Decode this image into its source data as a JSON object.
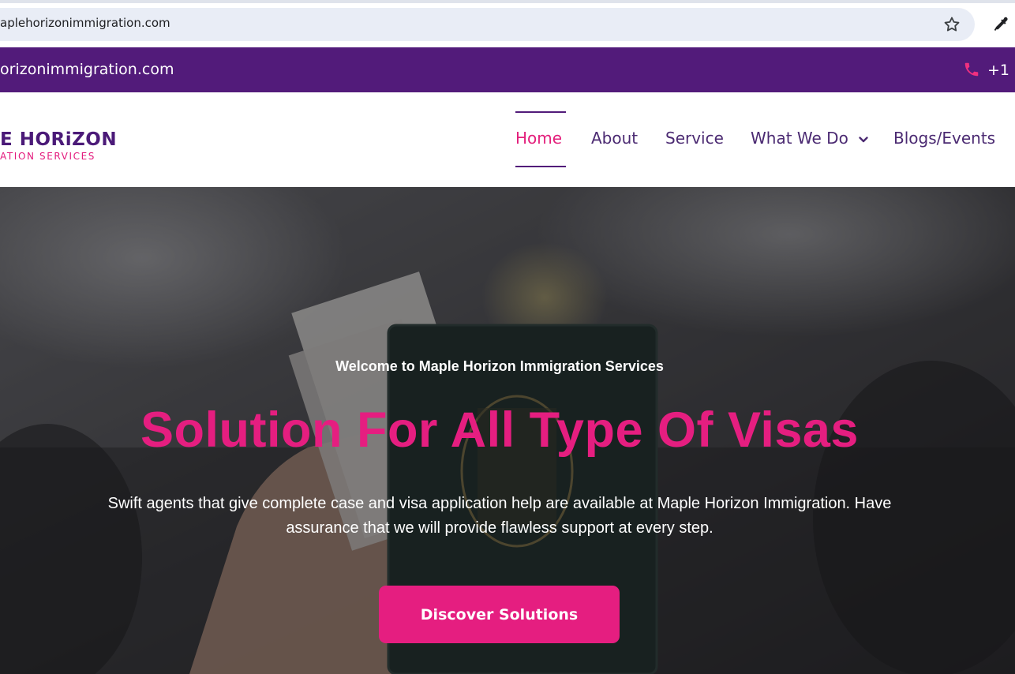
{
  "browser": {
    "url": "aplehorizonimmigration.com"
  },
  "topbar": {
    "email": "orizonimmigration.com",
    "phone": "+1 ("
  },
  "header": {
    "logo": {
      "line1": "E HORiZON",
      "line2": "ATION SERVICES"
    },
    "nav": [
      {
        "label": "Home",
        "active": true
      },
      {
        "label": "About"
      },
      {
        "label": "Service"
      },
      {
        "label": "What We Do"
      },
      {
        "label": "Blogs/Events"
      }
    ]
  },
  "hero": {
    "welcome": "Welcome to Maple Horizon Immigration Services",
    "title": "Solution For All Type Of Visas",
    "description": "Swift agents that give complete case and visa application help are available at Maple Horizon Immigration. Have assurance that we will provide flawless support at every step.",
    "button_label": "Discover Solutions"
  },
  "colors": {
    "brand_purple": "#521b7a",
    "accent_pink": "#e51e80",
    "nav_text": "#4b2a72"
  }
}
